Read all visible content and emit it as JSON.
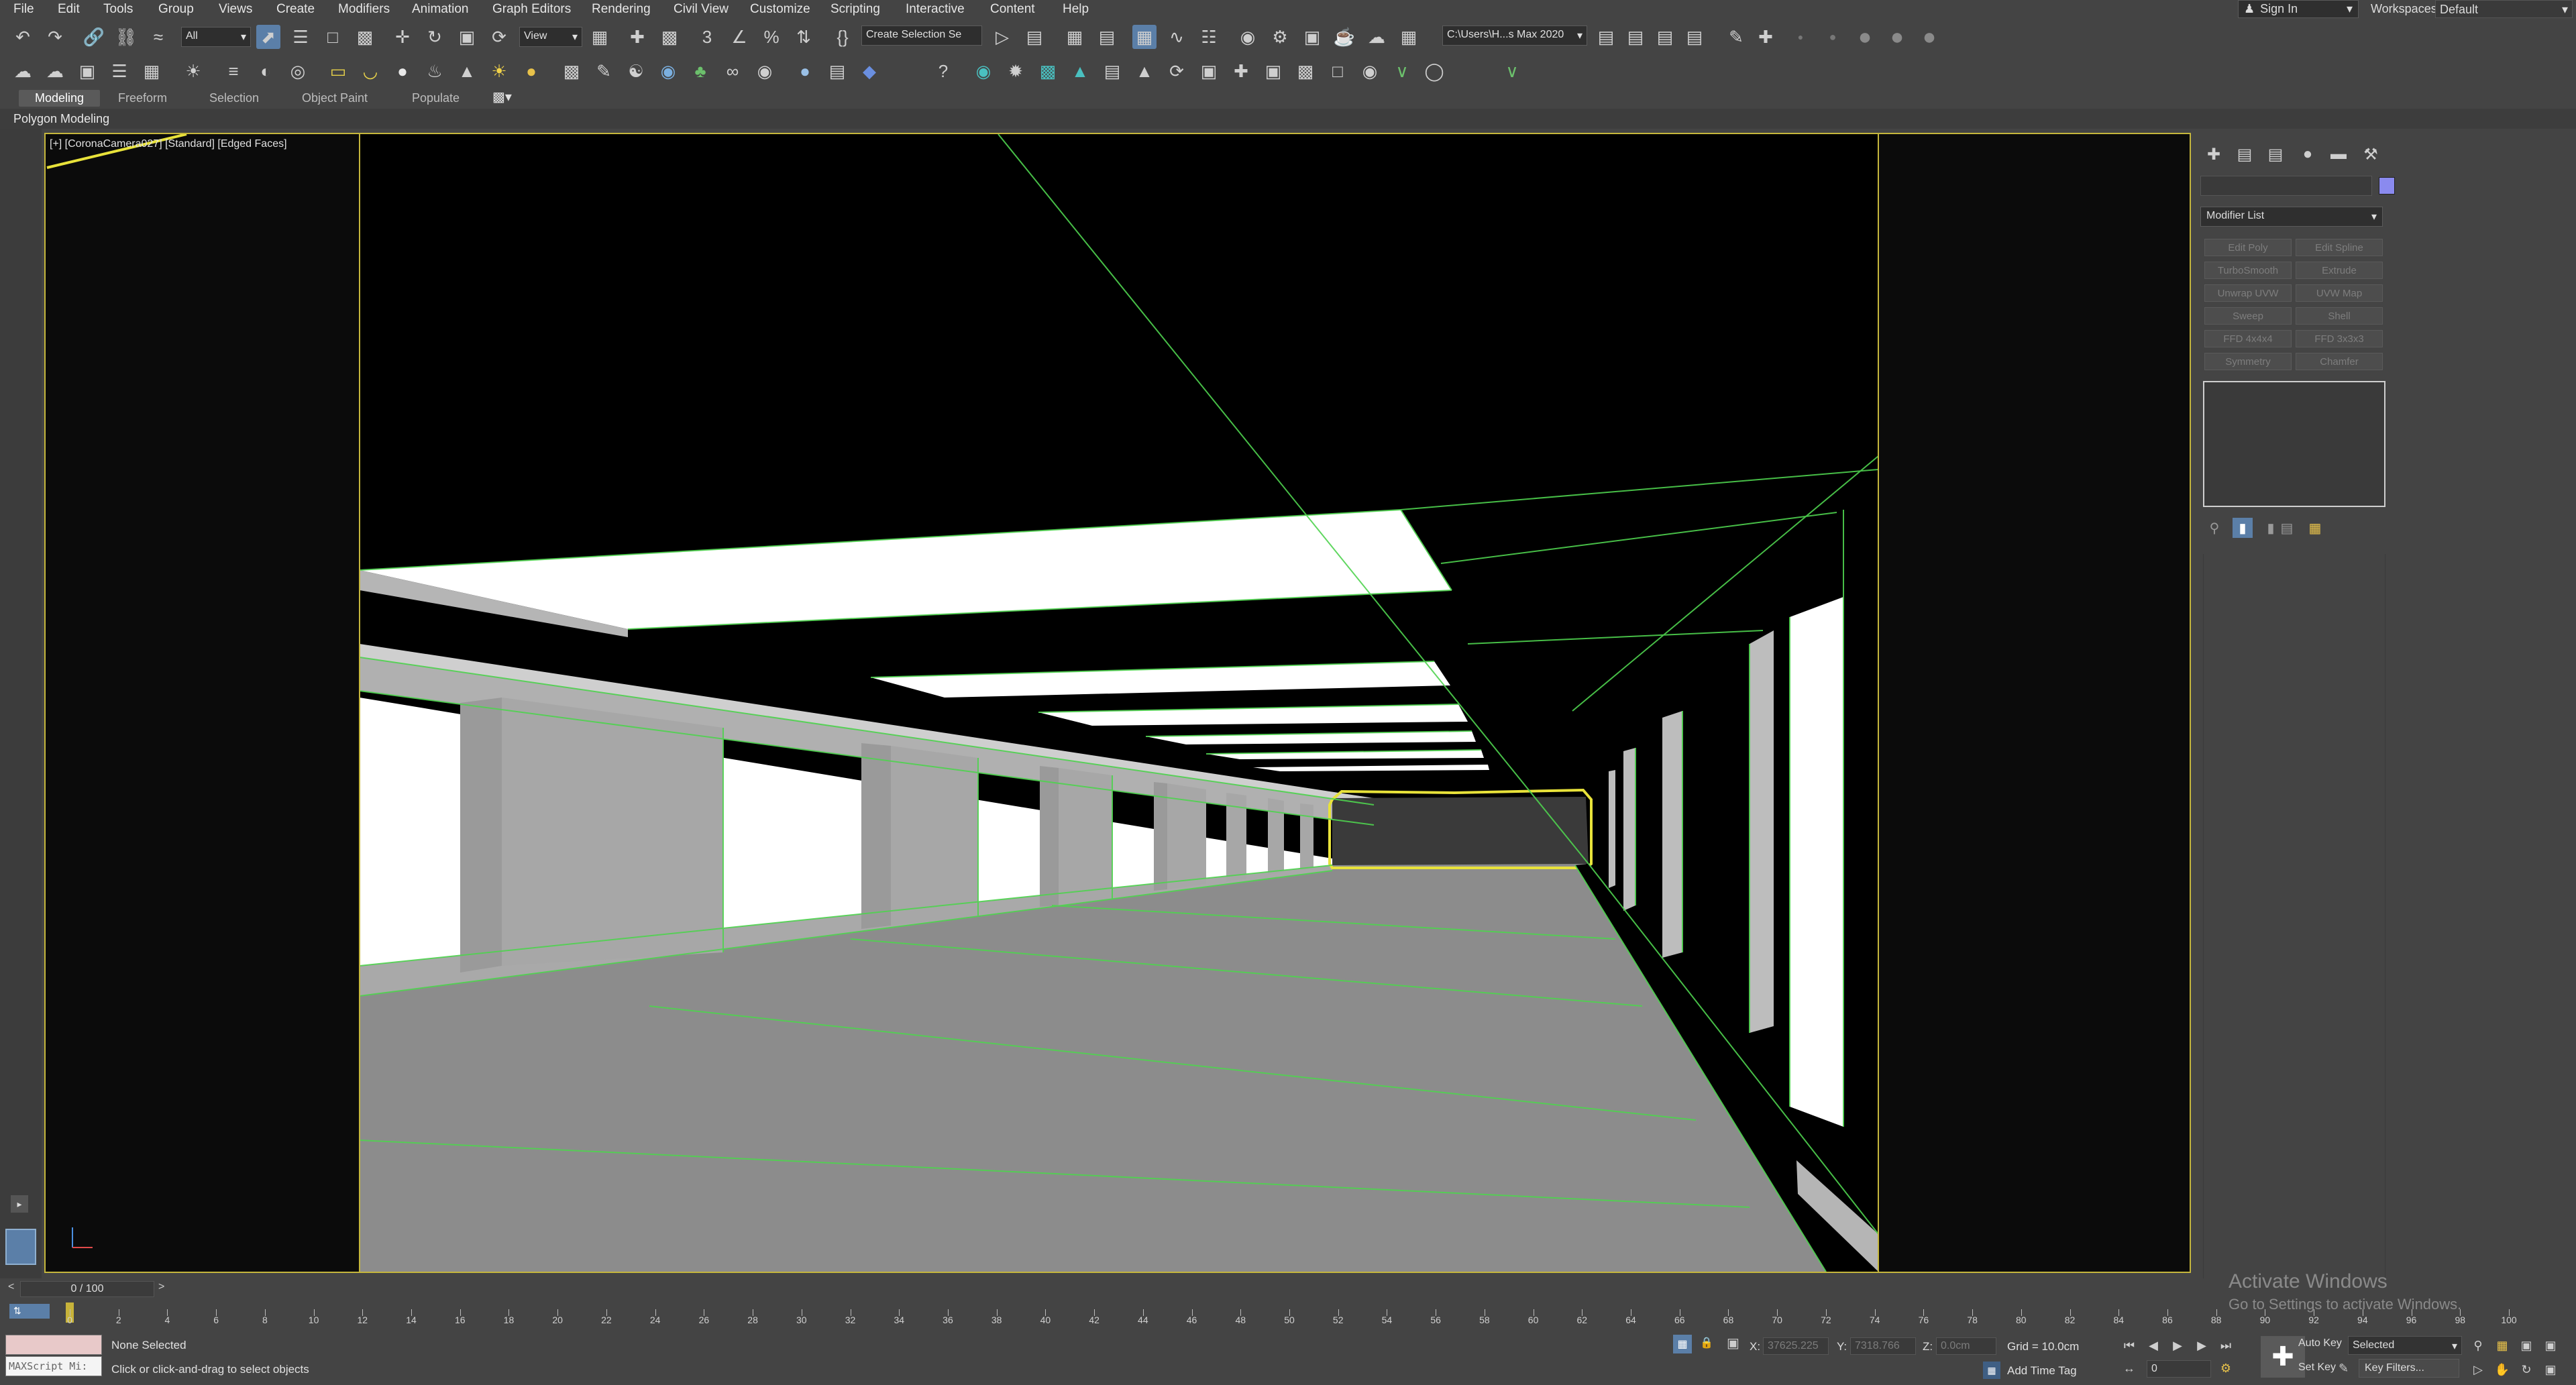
{
  "menubar": {
    "items": [
      "File",
      "Edit",
      "Tools",
      "Group",
      "Views",
      "Create",
      "Modifiers",
      "Animation",
      "Graph Editors",
      "Rendering",
      "Civil View",
      "Customize",
      "Scripting",
      "Interactive",
      "Content",
      "Help"
    ],
    "signin_label": "Sign In",
    "workspaces_label": "Workspaces:",
    "workspace_value": "Default"
  },
  "toolbar": {
    "filter_value": "All",
    "ref_coord_value": "View",
    "selection_set_value": "Create Selection Se",
    "project_path": "C:\\Users\\H...s Max 2020"
  },
  "ribbon": {
    "tabs": [
      "Modeling",
      "Freeform",
      "Selection",
      "Object Paint",
      "Populate"
    ],
    "active_tab": "Modeling",
    "panel_label": "Polygon Modeling"
  },
  "viewport": {
    "label": "[+] [CoronaCamera027] [Standard] [Edged Faces]",
    "border_color": "#c5b63c",
    "wire_color": "#4fd34f"
  },
  "command_panel": {
    "modifier_list_label": "Modifier List",
    "modifier_buttons": [
      "Edit Poly",
      "Edit Spline",
      "TurboSmooth",
      "Extrude",
      "Unwrap UVW",
      "UVW Map",
      "Sweep",
      "Shell",
      "FFD 4x4x4",
      "FFD 3x3x3",
      "Symmetry",
      "Chamfer"
    ],
    "swatch_color": "#8a8aef"
  },
  "timeline": {
    "frame_label": "0 / 100",
    "ticks": [
      "0",
      "2",
      "4",
      "6",
      "8",
      "10",
      "12",
      "14",
      "16",
      "18",
      "20",
      "22",
      "24",
      "26",
      "28",
      "30",
      "32",
      "34",
      "36",
      "38",
      "40",
      "42",
      "44",
      "46",
      "48",
      "50",
      "52",
      "54",
      "56",
      "58",
      "60",
      "62",
      "64",
      "66",
      "68",
      "70",
      "72",
      "74",
      "76",
      "78",
      "80",
      "82",
      "84",
      "86",
      "88",
      "90",
      "92",
      "94",
      "96",
      "98",
      "100"
    ]
  },
  "status": {
    "maxscript_label": "MAXScript Mi:",
    "selection_text": "None Selected",
    "prompt_text": "Click or click-and-drag to select objects",
    "x_label": "X:",
    "x_value": "37625.225",
    "y_label": "Y:",
    "y_value": "7318.766",
    "z_label": "Z:",
    "z_value": "0.0cm",
    "grid_text": "Grid = 10.0cm",
    "add_time_tag": "Add Time Tag",
    "auto_key": "Auto Key",
    "set_key": "Set Key",
    "selected_value": "Selected",
    "key_filters": "Key Filters...",
    "current_frame": "0"
  },
  "watermark": {
    "title": "Activate Windows",
    "subtitle": "Go to Settings to activate Windows."
  }
}
